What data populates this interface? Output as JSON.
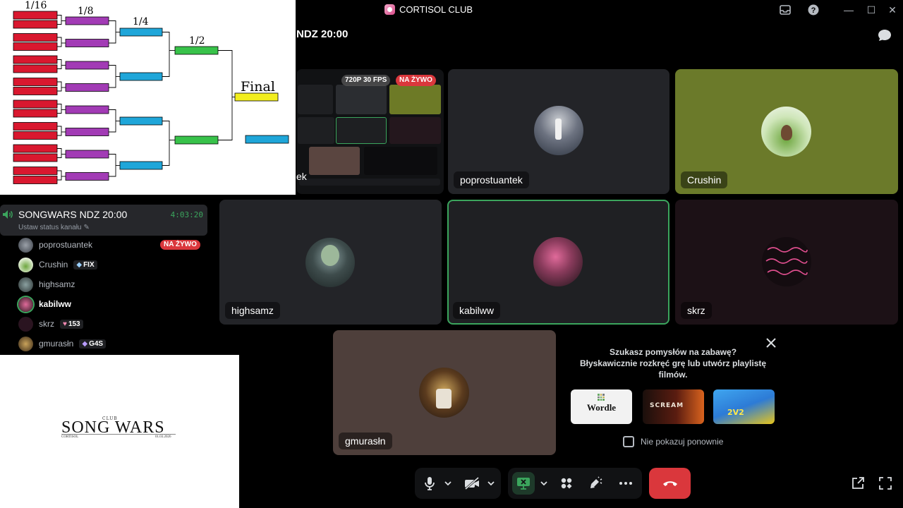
{
  "window": {
    "title": "CORTISOL CLUB",
    "minimize_glyph": "—",
    "maximize_glyph": "☐",
    "close_glyph": "✕"
  },
  "channel_header": {
    "title_partial": "NDZ 20:00"
  },
  "stream_tile": {
    "resolution_badge": "720P 30 FPS",
    "live_badge": "NA ŻYWO",
    "owner_partial": "ek"
  },
  "tiles": [
    {
      "name": "poprostuantek"
    },
    {
      "name": "Crushin"
    },
    {
      "name": "highsamz"
    },
    {
      "name": "kabilww",
      "speaking": true
    },
    {
      "name": "skrz"
    },
    {
      "name": "gmurasłn"
    }
  ],
  "bracket": {
    "rounds": [
      "1/16",
      "1/8",
      "1/4",
      "1/2",
      "Final"
    ]
  },
  "sidebar": {
    "channel_name": "SONGWARS NDZ 20:00",
    "timer": "4:03:20",
    "status_hint": "Ustaw status kanału",
    "members": [
      {
        "name": "poprostuantek",
        "badge": "",
        "live": "NA ŻYWO"
      },
      {
        "name": "Crushin",
        "badge": "FIX",
        "live": ""
      },
      {
        "name": "highsamz",
        "badge": "",
        "live": ""
      },
      {
        "name": "kabilww",
        "badge": "",
        "live": "",
        "active": true
      },
      {
        "name": "skrz",
        "badge": "153",
        "live": ""
      },
      {
        "name": "gmurasłn",
        "badge": "G4S",
        "live": ""
      }
    ]
  },
  "logo": {
    "club": "CLUB",
    "title": "SONG WARS",
    "subtitle": "CORTISOL",
    "date": "01.03.2026"
  },
  "popup": {
    "line1": "Szukasz pomysłów na zabawę?",
    "line2": "Błyskawicznie rozkręć grę lub utwórz playlistę filmów.",
    "games": [
      "Wordle",
      "SCREAM",
      "2V2"
    ],
    "checkbox_label": "Nie pokazuj ponownie"
  },
  "colors": {
    "accent_green": "#3ba55d",
    "live_red": "#da373c",
    "bracket_red": "#d9182f",
    "bracket_purple": "#a23bb5",
    "bracket_blue": "#1fa6d9",
    "bracket_green": "#38c24a",
    "bracket_yellow": "#f2ee1e"
  }
}
